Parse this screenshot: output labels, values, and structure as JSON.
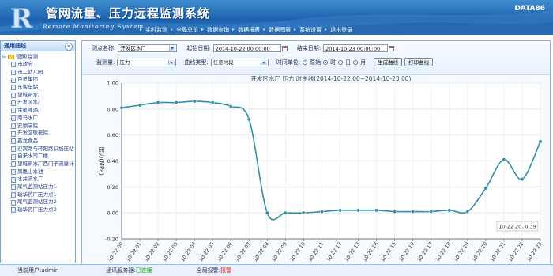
{
  "app": {
    "title": "管网流量、压力远程监测系统",
    "subtitle": "Remote Monitoring System",
    "brand": "DATA86"
  },
  "nav": [
    "实时监测",
    "全局总览",
    "数据查询",
    "数据报表",
    "数据图表",
    "系统设置",
    "退出登录"
  ],
  "sidebar": {
    "title": "通用曲线",
    "collapse_icon": "double-chevron-up-icon",
    "root": "管网监测",
    "items": [
      "市政府",
      "市二幼儿园",
      "百灵集团",
      "东客车站",
      "望城新水厂",
      "开发区水厂",
      "金星啤酒厂",
      "南马水厂",
      "安顺学院",
      "开发区敬老院",
      "鑫龙食品",
      "迎宾路与环阳路口加压站",
      "自来水司二楼",
      "望城新水厂西门子流量计",
      "凤凰山水池",
      "水井流水厂",
      "尾气监测站压力1",
      "瑞华药厂压力点1",
      "尾气监测站压力2",
      "瑞华药厂压力点2"
    ]
  },
  "filters": {
    "station_label": "测点名称:",
    "station_value": "开发区水厂",
    "start_label": "起始日期:",
    "start_value": "2014-10-22 00:00:00",
    "end_label": "结束日期:",
    "end_value": "2014-10-23 00:00:00",
    "qty_label": "监测量:",
    "qty_value": "压力",
    "type_label": "曲线类型:",
    "type_value": "任意时段",
    "unit_label": "时间单位:",
    "unit_options": [
      "原始",
      "时",
      "日",
      "月"
    ],
    "unit_selected": "时",
    "generate_btn": "生成曲线",
    "print_btn": "打印曲线"
  },
  "status": {
    "user_label": "当前用户:",
    "user_value": "admin",
    "server_label": "通讯服务器:",
    "server_value": "已连接",
    "alarm_label": "全局报警:",
    "alarm_value": "报警",
    "colors": {
      "connected": "#14a514",
      "alarm": "#d01f1f"
    }
  },
  "chart_data": {
    "type": "line",
    "title": "开发区水厂 压力 时曲线(2014-10-22 00~2014-10-23 00)",
    "ylabel": "压力(MPa)",
    "xlabel": "",
    "ylim": [
      -0.2,
      1.0
    ],
    "yticks": [
      "1.00",
      "0.80",
      "0.60",
      "0.40",
      "0.20",
      "0.00",
      "-0.20"
    ],
    "categories": [
      "10-22 00",
      "10-22 01",
      "10-22 02",
      "10-22 03",
      "10-22 04",
      "10-22 05",
      "10-22 06",
      "10-22 07",
      "10-22 08",
      "10-22 09",
      "10-22 10",
      "10-22 11",
      "10-22 12",
      "10-22 13",
      "10-22 14",
      "10-22 15",
      "10-22 16",
      "10-22 17",
      "10-22 18",
      "10-22 19",
      "10-22 20",
      "10-22 21",
      "10-22 22",
      "10-22 23"
    ],
    "values": [
      0.81,
      0.83,
      0.85,
      0.85,
      0.86,
      0.85,
      0.82,
      0.72,
      0.0,
      0.0,
      0.0,
      0.01,
      0.02,
      0.02,
      0.02,
      0.01,
      0.01,
      0.01,
      0.02,
      0.01,
      0.19,
      0.41,
      0.26,
      0.55
    ],
    "grid": true,
    "line_color": "#2e8fa6",
    "tooltip": "10-22 20, 0.39"
  }
}
